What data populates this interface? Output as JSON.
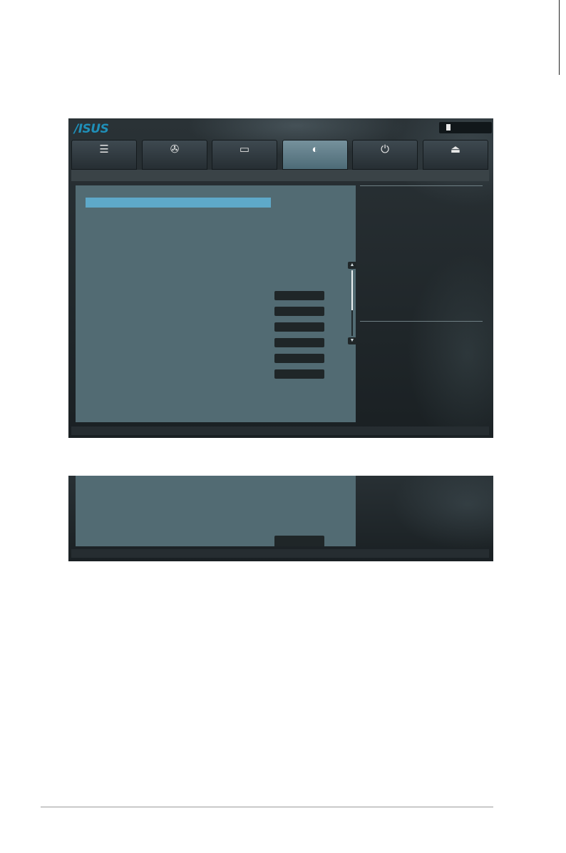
{
  "app": {
    "logo": "/ISUS",
    "exit_icon": "exit-door-icon"
  },
  "tabs": [
    {
      "id": "main",
      "icon": "list-icon",
      "glyph": "☰",
      "active": false
    },
    {
      "id": "ai-tweaker",
      "icon": "tweaker-icon",
      "glyph": "✇",
      "active": false
    },
    {
      "id": "advanced",
      "icon": "advanced-info-icon",
      "glyph": "▭",
      "active": false
    },
    {
      "id": "monitor",
      "icon": "monitor-thermometer-icon",
      "glyph": "◐",
      "active": true
    },
    {
      "id": "boot",
      "icon": "power-icon",
      "glyph": "⏻",
      "active": false
    },
    {
      "id": "tool",
      "icon": "tool-icon",
      "glyph": "⏏",
      "active": false
    }
  ],
  "scroll": {
    "up_glyph": "▲",
    "down_glyph": "▼",
    "position": 0.6
  },
  "colors": {
    "accent": "#5ea9c9",
    "panel": "#526b73",
    "frame": "#1c2226",
    "logo": "#1f8fb8"
  }
}
